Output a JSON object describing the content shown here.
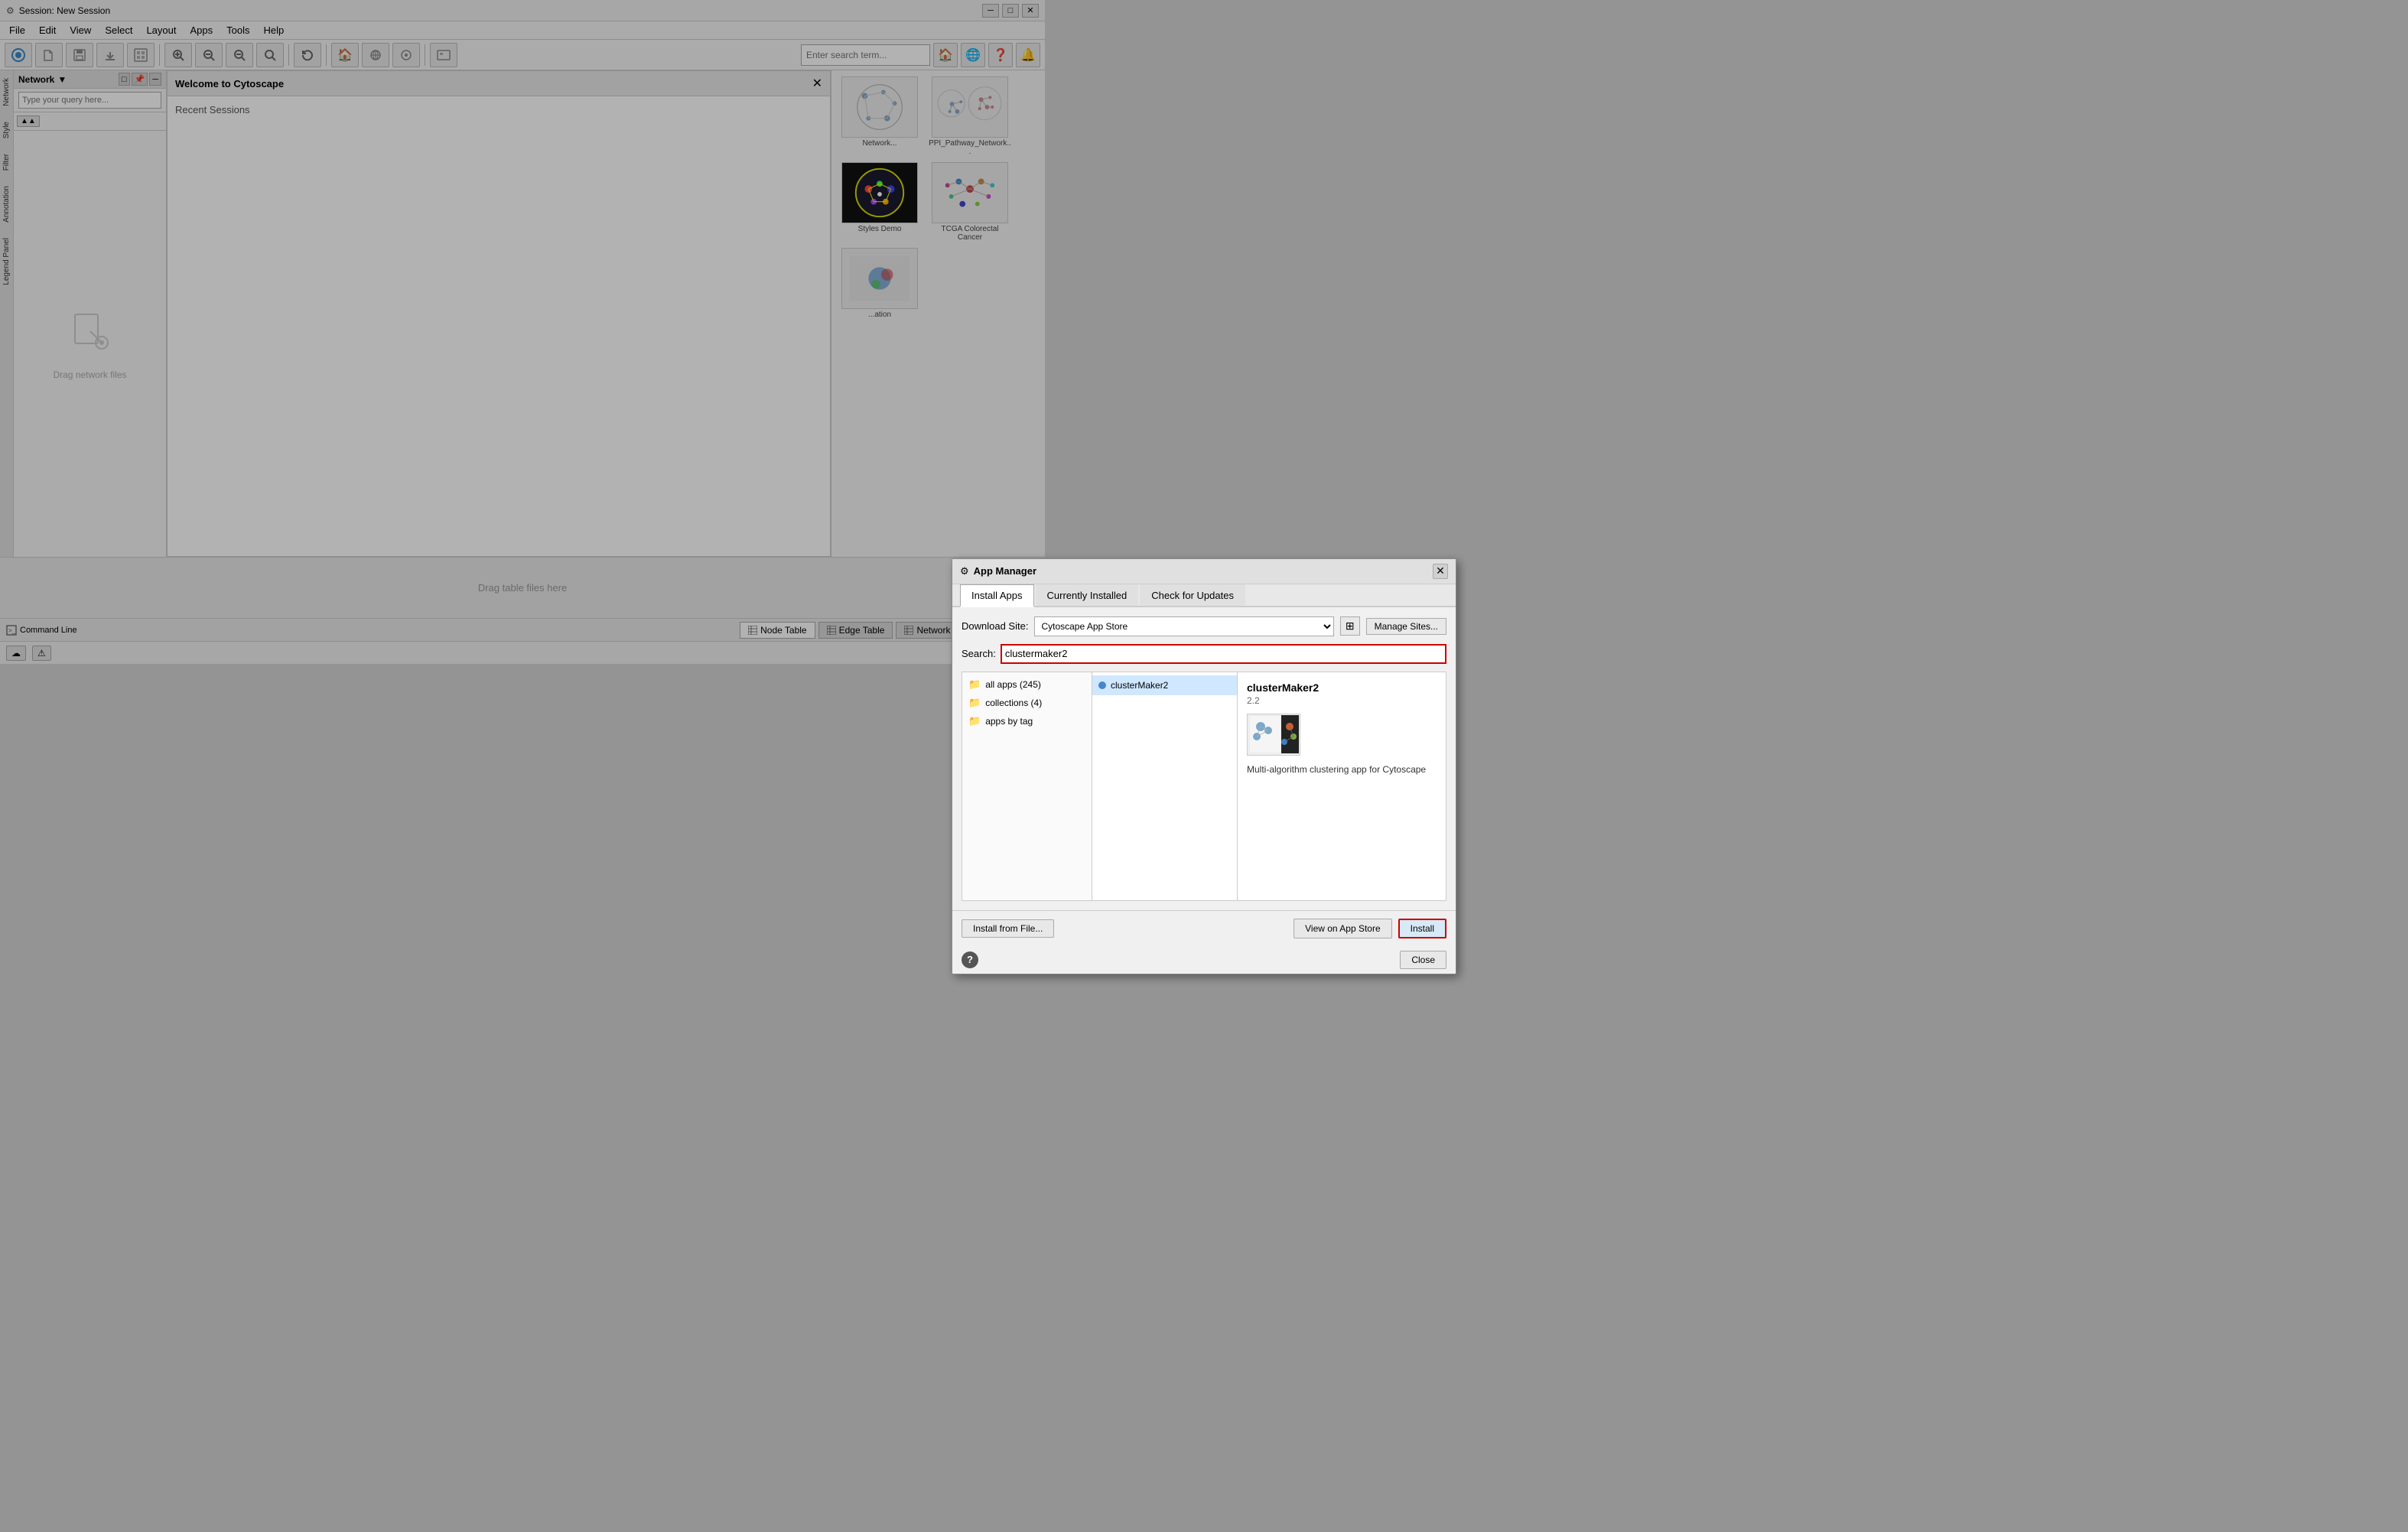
{
  "window": {
    "title": "Session: New Session"
  },
  "menubar": {
    "items": [
      "File",
      "Edit",
      "View",
      "Select",
      "Layout",
      "Apps",
      "Tools",
      "Help"
    ]
  },
  "toolbar": {
    "search_placeholder": "Enter search term...",
    "home_icon": "🏠",
    "globe_icon": "🌐",
    "help_icon": "❓",
    "bell_icon": "🔔"
  },
  "network_panel": {
    "title": "Network",
    "dropdown_indicator": "▼",
    "drag_text": "Drag network files"
  },
  "welcome_panel": {
    "title": "Welcome to Cytoscape",
    "recent_sessions_label": "Recent Sessions"
  },
  "right_panel": {
    "thumbnails": [
      {
        "label": "Network...",
        "type": "scatter"
      },
      {
        "label": "PPI_Pathway_Network...",
        "type": "network"
      },
      {
        "label": "Styles Demo",
        "type": "circle"
      },
      {
        "label": "TCGA Colorectal Cancer",
        "type": "tree"
      },
      {
        "label": "...ation",
        "type": "map"
      }
    ]
  },
  "sidebar_tabs": {
    "tabs": [
      "Network",
      "Style",
      "Filter",
      "Annotation",
      "Legend Panel"
    ]
  },
  "dialog": {
    "title": "App Manager",
    "title_icon": "⚙",
    "tabs": [
      "Install Apps",
      "Currently Installed",
      "Check for Updates"
    ],
    "active_tab": "Install Apps",
    "download_site_label": "Download Site:",
    "download_site_value": "Cytoscape App Store",
    "manage_sites_btn": "Manage Sites...",
    "search_label": "Search:",
    "search_value": "clustermaker2",
    "app_list": [
      {
        "label": "all apps (245)",
        "type": "folder"
      },
      {
        "label": "collections (4)",
        "type": "folder"
      },
      {
        "label": "apps by tag",
        "type": "folder"
      }
    ],
    "app_results": [
      {
        "label": "clusterMaker2",
        "selected": true
      }
    ],
    "app_detail": {
      "name": "clusterMaker2",
      "version": "2.2",
      "description": "Multi-algorithm clustering app for Cytoscape"
    },
    "install_from_file_btn": "Install from File...",
    "view_on_app_store_btn": "View on App Store",
    "install_btn": "Install",
    "close_btn": "Close"
  },
  "bottom_tabs": {
    "command_line_label": "Command Line",
    "node_table_label": "Node Table",
    "edge_table_label": "Edge Table",
    "network_table_label": "Network Table",
    "drag_table_text": "Drag table files here"
  },
  "status_bar": {
    "cloud_icon": "☁",
    "warning_icon": "⚠",
    "indicator_color": "#22aa22"
  }
}
